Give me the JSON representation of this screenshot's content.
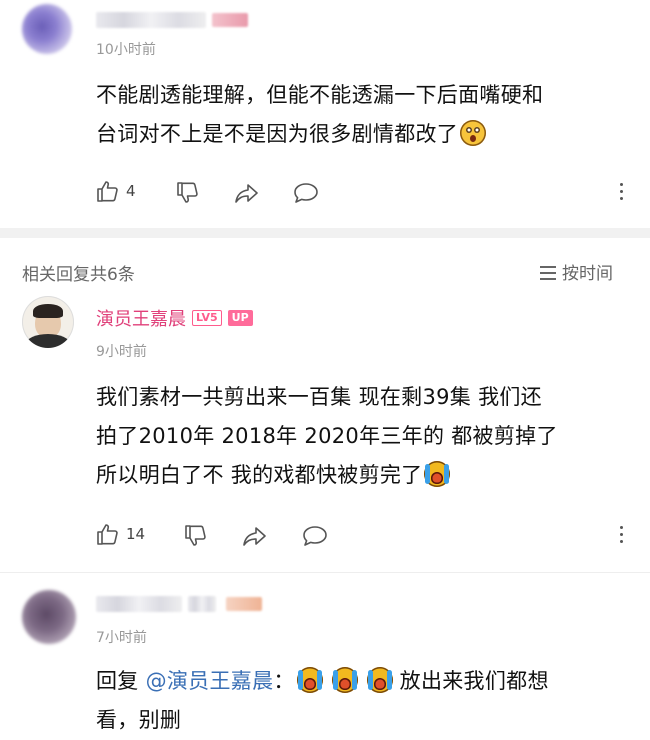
{
  "comment1": {
    "time": "10小时前",
    "text_line1": "不能剧透能理解，但能不能透漏一下后面嘴硬和",
    "text_line2": "台词对不上是不是因为很多剧情都改了",
    "emoji": "astonished-emoji",
    "likes": "4"
  },
  "replies_header": {
    "count_label": "相关回复共6条",
    "sort_label": "按时间"
  },
  "reply1": {
    "author": "演员王嘉晨",
    "level_badge": "LV5",
    "up_badge": "UP",
    "time": "9小时前",
    "text_line1": "我们素材一共剪出来一百集 现在剩39集 我们还",
    "text_line2": "拍了2010年 2018年 2020年三年的 都被剪掉了",
    "text_line3": "所以明白了不 我的戏都快被剪完了",
    "emoji": "crying-emoji",
    "likes": "14"
  },
  "reply2": {
    "time": "7小时前",
    "reply_prefix": "回复 ",
    "mention": "@演员王嘉晨",
    "colon": "：",
    "text_after": "放出来我们都想",
    "text_line2": "看，别删"
  },
  "colors": {
    "accent_pink": "#e0407a",
    "mention_blue": "#3a6fb5",
    "meta_gray": "#999999"
  }
}
